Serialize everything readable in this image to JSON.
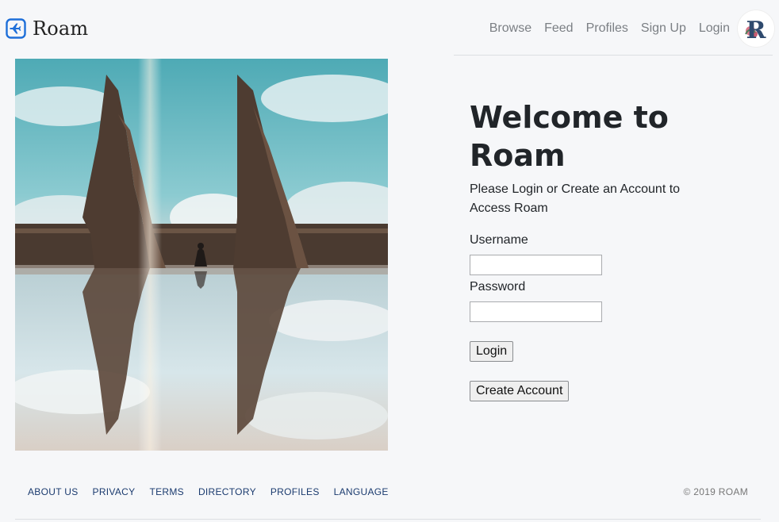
{
  "brand": {
    "name": "Roam",
    "icon": "airplane-icon",
    "accent": "#1e6fd9"
  },
  "nav": {
    "items": [
      {
        "label": "Browse"
      },
      {
        "label": "Feed"
      },
      {
        "label": "Profiles"
      },
      {
        "label": "Sign Up"
      },
      {
        "label": "Login"
      }
    ],
    "avatar_letter": "R"
  },
  "hero": {
    "alt": "Temple gate reflected in water"
  },
  "welcome": {
    "title": "Welcome to Roam",
    "subtitle": "Please Login or Create an Account to Access Roam"
  },
  "form": {
    "username_label": "Username",
    "username_value": "",
    "password_label": "Password",
    "password_value": "",
    "login_button": "Login",
    "create_button": "Create Account"
  },
  "footer": {
    "links": [
      {
        "label": "ABOUT US"
      },
      {
        "label": "PRIVACY"
      },
      {
        "label": "TERMS"
      },
      {
        "label": "DIRECTORY"
      },
      {
        "label": "PROFILES"
      },
      {
        "label": "LANGUAGE"
      }
    ],
    "copyright": "© 2019 ROAM"
  }
}
